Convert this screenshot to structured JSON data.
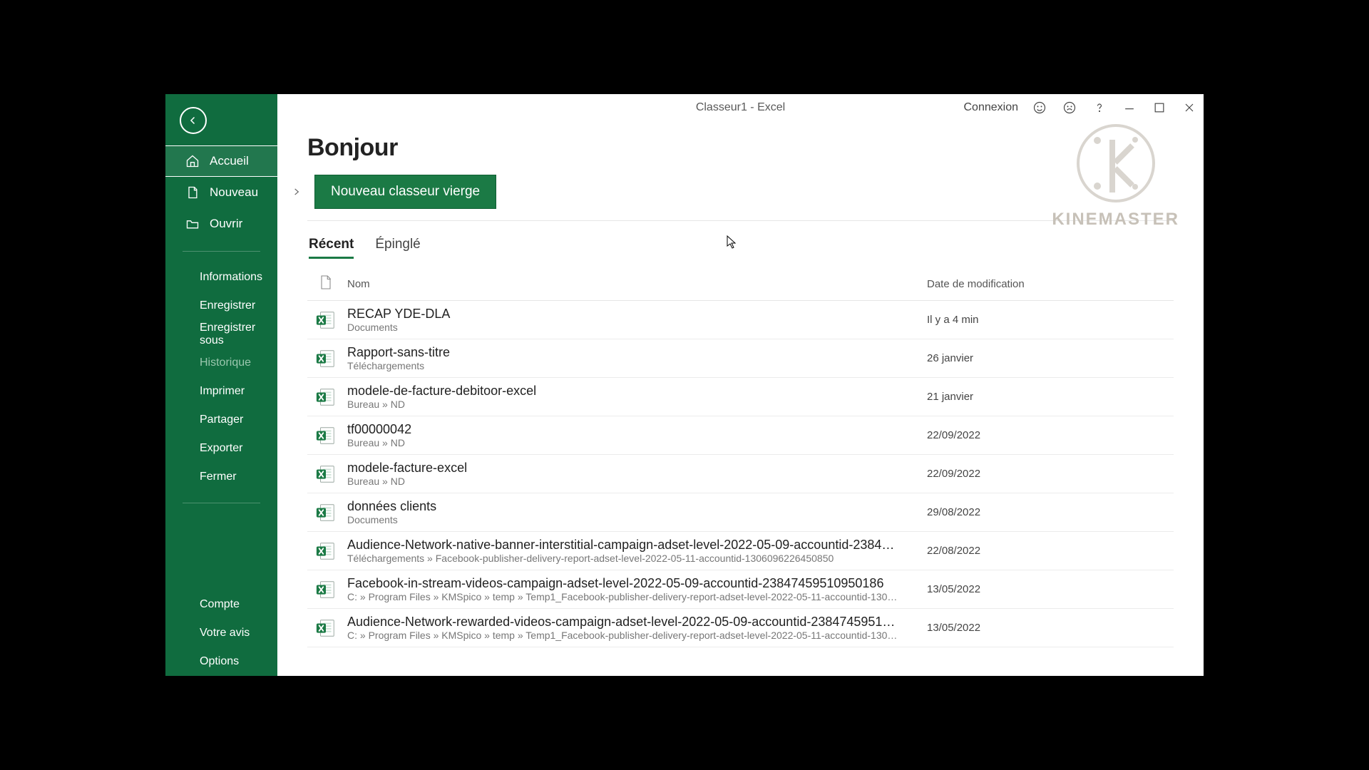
{
  "window": {
    "title": "Classeur1  -  Excel"
  },
  "titlebar": {
    "signin": "Connexion"
  },
  "sidebar": {
    "home": {
      "label": "Accueil"
    },
    "new": {
      "label": "Nouveau"
    },
    "open": {
      "label": "Ouvrir"
    },
    "info": {
      "label": "Informations"
    },
    "save": {
      "label": "Enregistrer"
    },
    "saveAs": {
      "label": "Enregistrer sous"
    },
    "history": {
      "label": "Historique"
    },
    "print": {
      "label": "Imprimer"
    },
    "share": {
      "label": "Partager"
    },
    "export": {
      "label": "Exporter"
    },
    "close": {
      "label": "Fermer"
    },
    "account": {
      "label": "Compte"
    },
    "feedback": {
      "label": "Votre avis"
    },
    "options": {
      "label": "Options"
    }
  },
  "greeting": "Bonjour",
  "newButton": "Nouveau classeur vierge",
  "tabs": {
    "recent": "Récent",
    "pinned": "Épinglé"
  },
  "headers": {
    "name": "Nom",
    "modified": "Date de modification"
  },
  "files": [
    {
      "name": "RECAP YDE-DLA",
      "path": "Documents",
      "date": "Il y a 4 min"
    },
    {
      "name": "Rapport-sans-titre",
      "path": "Téléchargements",
      "date": "26 janvier"
    },
    {
      "name": "modele-de-facture-debitoor-excel",
      "path": "Bureau » ND",
      "date": "21 janvier"
    },
    {
      "name": "tf00000042",
      "path": "Bureau » ND",
      "date": "22/09/2022"
    },
    {
      "name": "modele-facture-excel",
      "path": "Bureau » ND",
      "date": "22/09/2022"
    },
    {
      "name": "données clients",
      "path": "Documents",
      "date": "29/08/2022"
    },
    {
      "name": "Audience-Network-native-banner-interstitial-campaign-adset-level-2022-05-09-accountid-2384…",
      "path": "Téléchargements » Facebook-publisher-delivery-report-adset-level-2022-05-11-accountid-1306096226450850",
      "date": "22/08/2022"
    },
    {
      "name": "Facebook-in-stream-videos-campaign-adset-level-2022-05-09-accountid-23847459510950186",
      "path": "C: » Program Files » KMSpico » temp » Temp1_Facebook-publisher-delivery-report-adset-level-2022-05-11-accountid-130…",
      "date": "13/05/2022"
    },
    {
      "name": "Audience-Network-rewarded-videos-campaign-adset-level-2022-05-09-accountid-2384745951…",
      "path": "C: » Program Files » KMSpico » temp » Temp1_Facebook-publisher-delivery-report-adset-level-2022-05-11-accountid-130…",
      "date": "13/05/2022"
    }
  ],
  "watermark": "KINEMASTER"
}
